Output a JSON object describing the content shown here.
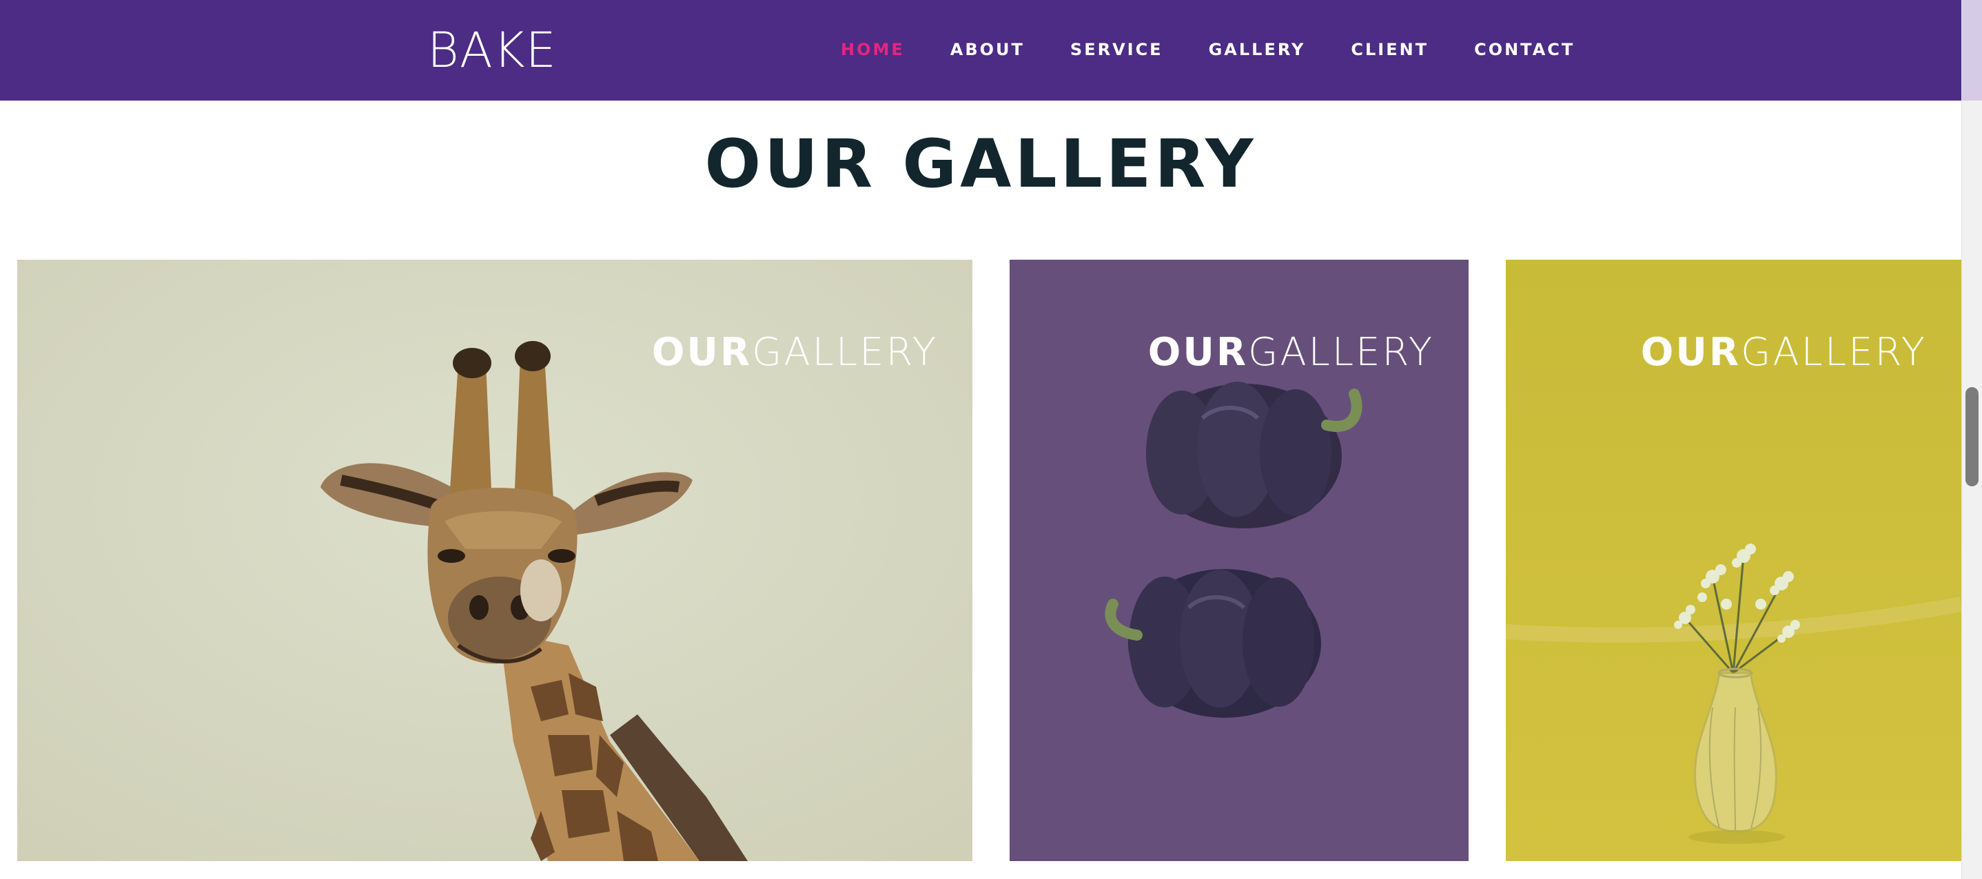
{
  "header": {
    "logo": "BAKE",
    "nav": [
      {
        "label": "HOME",
        "active": true
      },
      {
        "label": "ABOUT",
        "active": false
      },
      {
        "label": "SERVICE",
        "active": false
      },
      {
        "label": "GALLERY",
        "active": false
      },
      {
        "label": "CLIENT",
        "active": false
      },
      {
        "label": "CONTACT",
        "active": false
      }
    ]
  },
  "gallery": {
    "title": "OUR GALLERY",
    "items": [
      {
        "caption_strong": "OUR",
        "caption_light": "GALLERY",
        "image": "giraffe",
        "background": "#d7d9c3"
      },
      {
        "caption_strong": "OUR",
        "caption_light": "GALLERY",
        "image": "purple-bell-peppers",
        "background": "#674f7b"
      },
      {
        "caption_strong": "OUR",
        "caption_light": "GALLERY",
        "image": "flower-vase",
        "background": "#ccbe3a"
      }
    ]
  },
  "colors": {
    "navbar": "#4c2c84",
    "nav_active": "#e6257f",
    "title": "#13262d"
  }
}
